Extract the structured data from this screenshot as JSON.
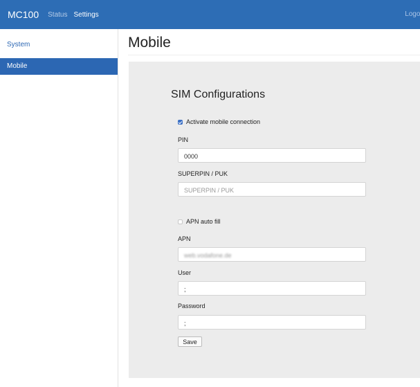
{
  "navbar": {
    "brand": "MC100",
    "links": [
      {
        "label": "Status"
      },
      {
        "label": "Settings"
      }
    ],
    "logout": "Logou"
  },
  "sidebar": {
    "items": [
      {
        "label": "System"
      },
      {
        "label": "Mobile"
      }
    ]
  },
  "page": {
    "title": "Mobile"
  },
  "form": {
    "section_title": "SIM Configurations",
    "activate_label": "Activate mobile connection",
    "activate_checked": true,
    "pin_label": "PIN",
    "pin_value": "0000",
    "puk_label": "SUPERPIN / PUK",
    "puk_placeholder": "SUPERPIN / PUK",
    "apn_auto_label": "APN auto fill",
    "apn_auto_checked": false,
    "apn_label": "APN",
    "apn_value": "web.vodafone.de",
    "user_label": "User",
    "user_value": ";",
    "password_label": "Password",
    "password_value": ";",
    "save_label": "Save"
  },
  "colors": {
    "navbar_bg": "#2d6db5",
    "sidebar_active_bg": "#2c67b3",
    "panel_bg": "#ececec",
    "checkbox_checked": "#3b6fc4"
  }
}
